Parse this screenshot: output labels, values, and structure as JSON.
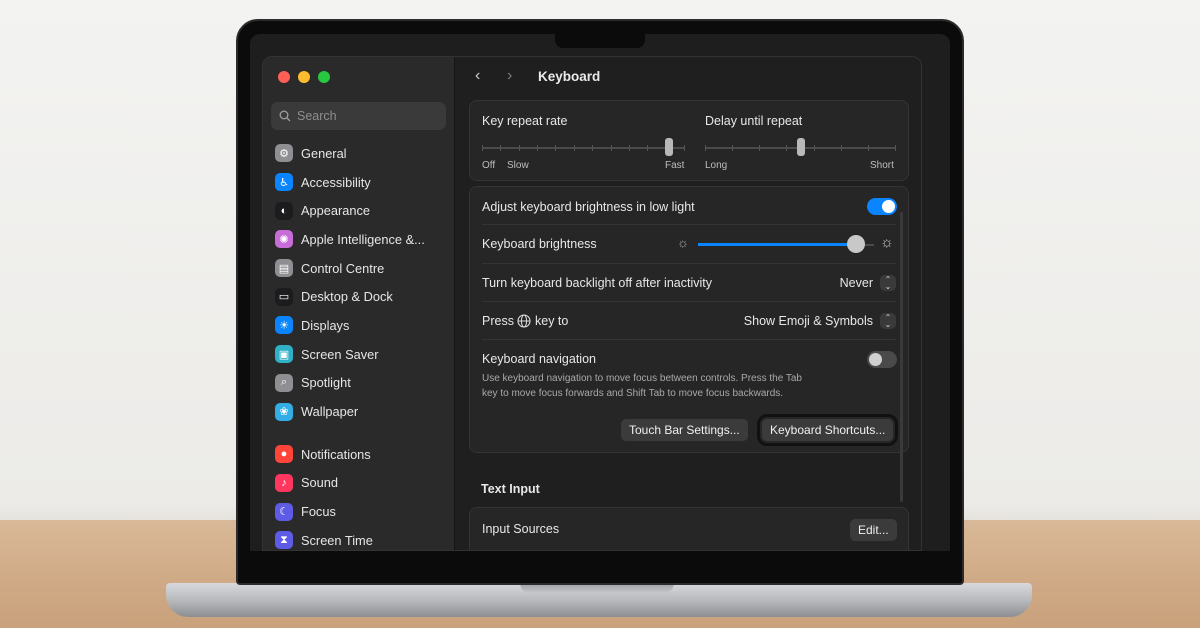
{
  "window": {
    "title": "Keyboard"
  },
  "sidebar": {
    "search_placeholder": "Search",
    "items": [
      {
        "label": "General",
        "icon": "gear-icon",
        "color": "#8e8e93"
      },
      {
        "label": "Accessibility",
        "icon": "accessibility-icon",
        "color": "#0a84ff"
      },
      {
        "label": "Appearance",
        "icon": "appearance-icon",
        "color": "#1c1c1e"
      },
      {
        "label": "Apple Intelligence &...",
        "icon": "apple-intelligence-icon",
        "color": "#c86dd7"
      },
      {
        "label": "Control Centre",
        "icon": "control-centre-icon",
        "color": "#8e8e93"
      },
      {
        "label": "Desktop & Dock",
        "icon": "dock-icon",
        "color": "#1c1c1e"
      },
      {
        "label": "Displays",
        "icon": "displays-icon",
        "color": "#0a84ff"
      },
      {
        "label": "Screen Saver",
        "icon": "screen-saver-icon",
        "color": "#30b0c7"
      },
      {
        "label": "Spotlight",
        "icon": "spotlight-icon",
        "color": "#8e8e93"
      },
      {
        "label": "Wallpaper",
        "icon": "wallpaper-icon",
        "color": "#32ade6"
      },
      {
        "label": "Notifications",
        "icon": "notifications-icon",
        "color": "#ff453a"
      },
      {
        "label": "Sound",
        "icon": "sound-icon",
        "color": "#ff375f"
      },
      {
        "label": "Focus",
        "icon": "focus-icon",
        "color": "#5e5ce6"
      },
      {
        "label": "Screen Time",
        "icon": "screen-time-icon",
        "color": "#5e5ce6"
      }
    ]
  },
  "key_repeat": {
    "rate_label": "Key repeat rate",
    "rate_off": "Off",
    "rate_slow": "Slow",
    "rate_fast": "Fast",
    "rate_value": 0.92,
    "delay_label": "Delay until repeat",
    "delay_long": "Long",
    "delay_short": "Short",
    "delay_value": 0.5
  },
  "settings": {
    "adjust_brightness_label": "Adjust keyboard brightness in low light",
    "adjust_brightness_on": true,
    "brightness_label": "Keyboard brightness",
    "brightness_value": 0.9,
    "backlight_label": "Turn keyboard backlight off after inactivity",
    "backlight_value": "Never",
    "press_key_prefix": "Press",
    "press_key_suffix": "key to",
    "press_key_value": "Show Emoji & Symbols",
    "nav_label": "Keyboard navigation",
    "nav_on": false,
    "nav_desc_line1": "Use keyboard navigation to move focus between controls. Press the Tab",
    "nav_desc_line2": "key to move focus forwards and Shift Tab to move focus backwards.",
    "touch_bar_button": "Touch Bar Settings...",
    "shortcuts_button": "Keyboard Shortcuts..."
  },
  "text_input": {
    "heading": "Text Input",
    "input_sources_label": "Input Sources",
    "edit_button": "Edit..."
  },
  "colors": {
    "accent": "#0a84ff"
  }
}
